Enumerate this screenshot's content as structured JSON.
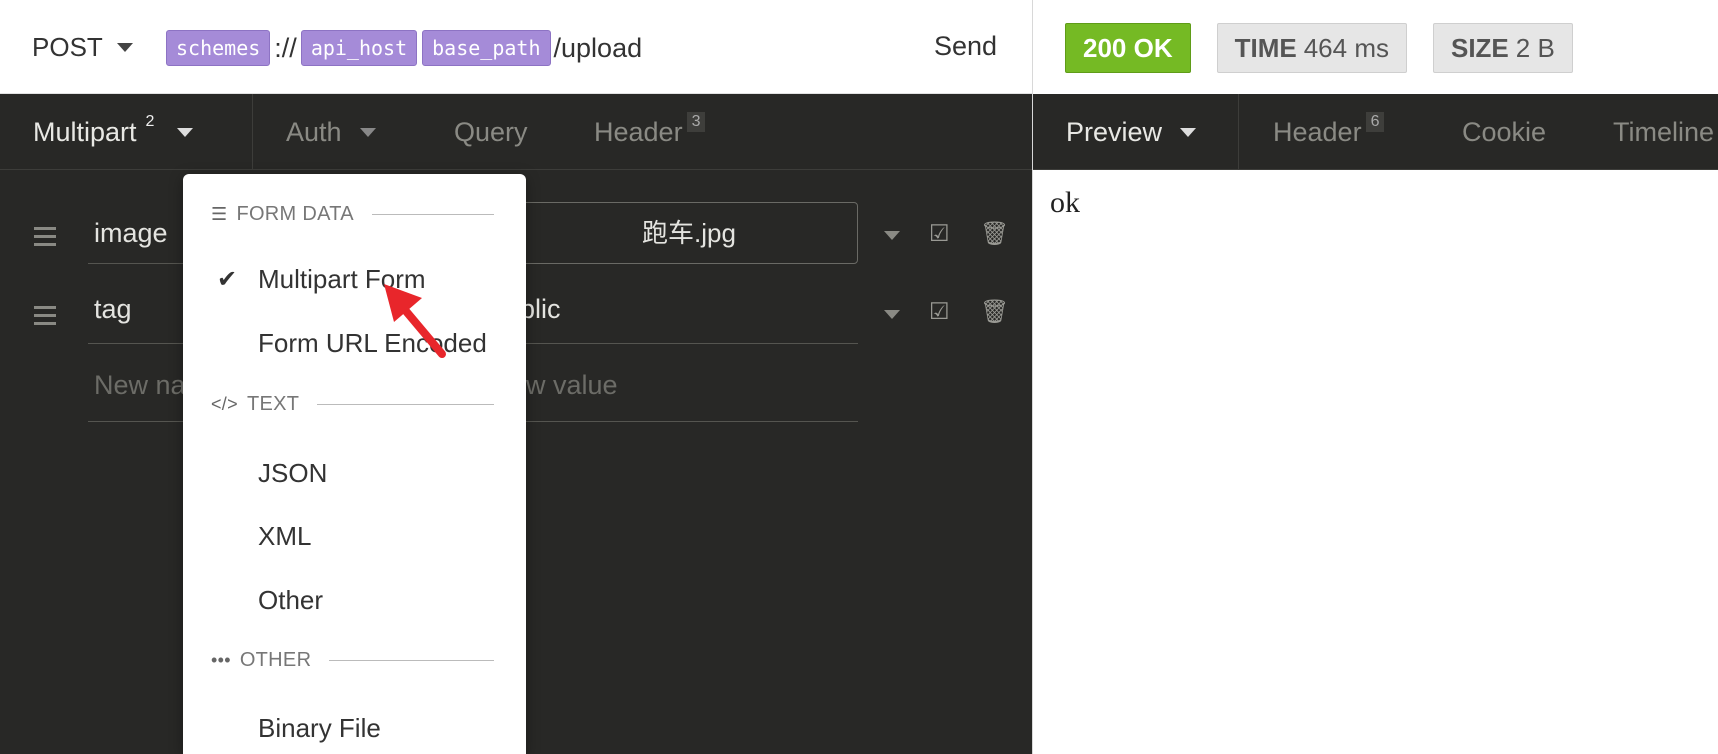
{
  "request": {
    "method": "POST",
    "url_vars": [
      "schemes",
      "api_host",
      "base_path"
    ],
    "url_sep": "://",
    "url_path": "/upload",
    "send_label": "Send"
  },
  "response": {
    "status": "200 OK",
    "time_label": "TIME",
    "time_value": "464 ms",
    "size_label": "SIZE",
    "size_value": "2 B",
    "body_text": "ok"
  },
  "request_tabs": [
    {
      "label": "Multipart",
      "count": "2"
    },
    {
      "label": "Auth"
    },
    {
      "label": "Query"
    },
    {
      "label": "Header",
      "count": "3"
    }
  ],
  "response_tabs": [
    {
      "label": "Preview"
    },
    {
      "label": "Header",
      "count": "6"
    },
    {
      "label": "Cookie"
    },
    {
      "label": "Timeline"
    }
  ],
  "params": [
    {
      "name": "image",
      "value": "跑车.jpg"
    },
    {
      "name": "tag",
      "value": "blic"
    }
  ],
  "new_param": {
    "name_placeholder": "New na",
    "value_placeholder": "w value"
  },
  "dropdown": {
    "sections": [
      {
        "title": "FORM DATA",
        "icon": "list-icon",
        "items": [
          "Multipart Form",
          "Form URL Encoded"
        ]
      },
      {
        "title": "TEXT",
        "icon": "code-icon",
        "items": [
          "JSON",
          "XML",
          "Other"
        ]
      },
      {
        "title": "OTHER",
        "icon": "ellipsis-icon",
        "items": [
          "Binary File"
        ]
      }
    ],
    "selected": "Multipart Form"
  },
  "colors": {
    "status_ok": "#75ba24",
    "url_var": "#a58bd8",
    "dark_bg": "#282826",
    "pointer_arrow": "#e8262b"
  }
}
